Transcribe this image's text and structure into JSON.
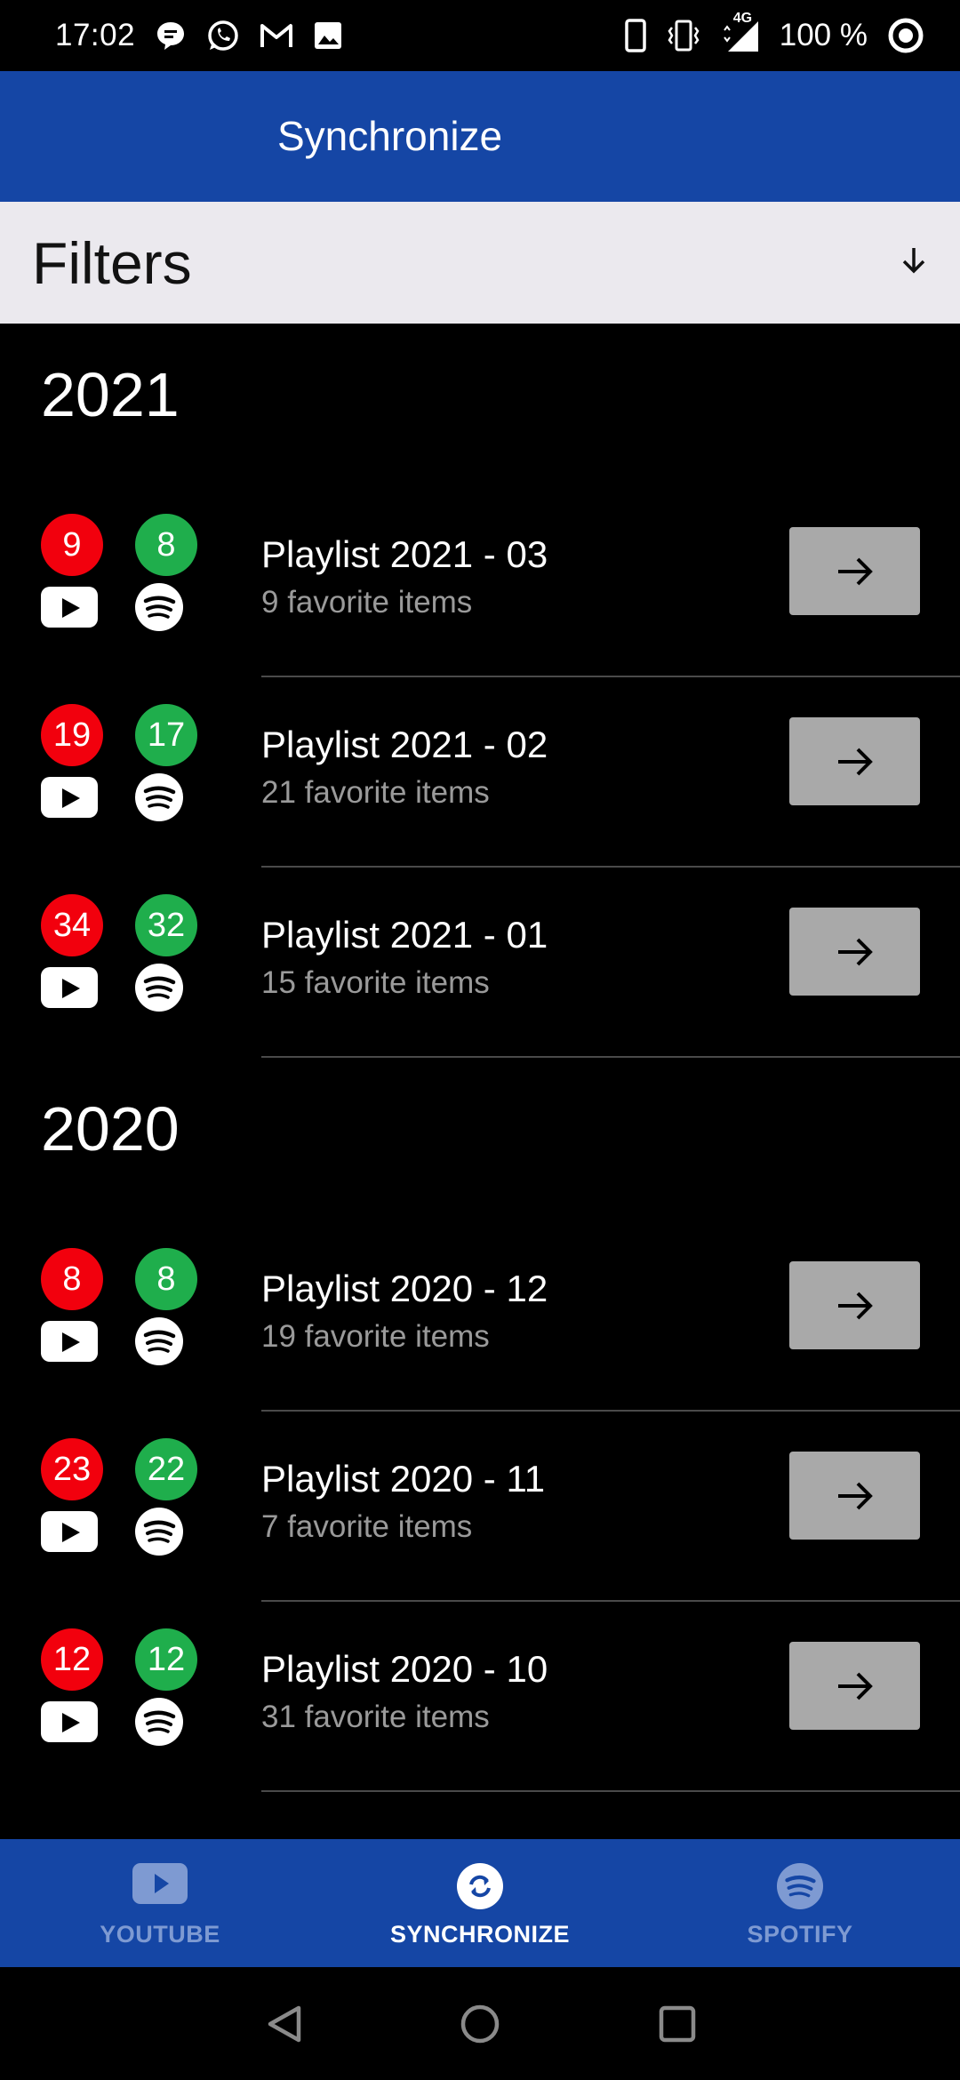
{
  "status_bar": {
    "time": "17:02",
    "battery_text": "100 %",
    "network_label": "4G",
    "notification_icons": [
      "chat-bubble-icon",
      "whatsapp-icon",
      "gmail-icon",
      "image-icon"
    ],
    "system_icons": [
      "phone-icon",
      "vibrate-icon",
      "signal-icon",
      "battery-saver-icon"
    ]
  },
  "app_bar": {
    "title": "Synchronize"
  },
  "filters": {
    "label": "Filters",
    "icon": "arrow-down-icon"
  },
  "sections": [
    {
      "year": "2021",
      "items": [
        {
          "youtube_count": "9",
          "spotify_count": "8",
          "title": "Playlist 2021 - 03",
          "subtitle": "9 favorite items"
        },
        {
          "youtube_count": "19",
          "spotify_count": "17",
          "title": "Playlist 2021 - 02",
          "subtitle": "21 favorite items"
        },
        {
          "youtube_count": "34",
          "spotify_count": "32",
          "title": "Playlist 2021 - 01",
          "subtitle": "15 favorite items"
        }
      ]
    },
    {
      "year": "2020",
      "items": [
        {
          "youtube_count": "8",
          "spotify_count": "8",
          "title": "Playlist 2020 - 12",
          "subtitle": "19 favorite items"
        },
        {
          "youtube_count": "23",
          "spotify_count": "22",
          "title": "Playlist 2020 - 11",
          "subtitle": "7 favorite items"
        },
        {
          "youtube_count": "12",
          "spotify_count": "12",
          "title": "Playlist 2020 - 10",
          "subtitle": "31 favorite items"
        }
      ]
    }
  ],
  "bottom_nav": {
    "items": [
      {
        "label": "YOUTUBE",
        "icon": "youtube-icon",
        "active": false
      },
      {
        "label": "SYNCHRONIZE",
        "icon": "sync-icon",
        "active": true
      },
      {
        "label": "SPOTIFY",
        "icon": "spotify-icon",
        "active": false
      }
    ]
  },
  "colors": {
    "primary": "#1546a5",
    "youtube_badge": "#f2000d",
    "spotify_badge": "#1fae4c",
    "filters_bg": "#ebe9ee",
    "arrow_button": "#a9a9a9",
    "nav_inactive": "#7e9ad2"
  }
}
